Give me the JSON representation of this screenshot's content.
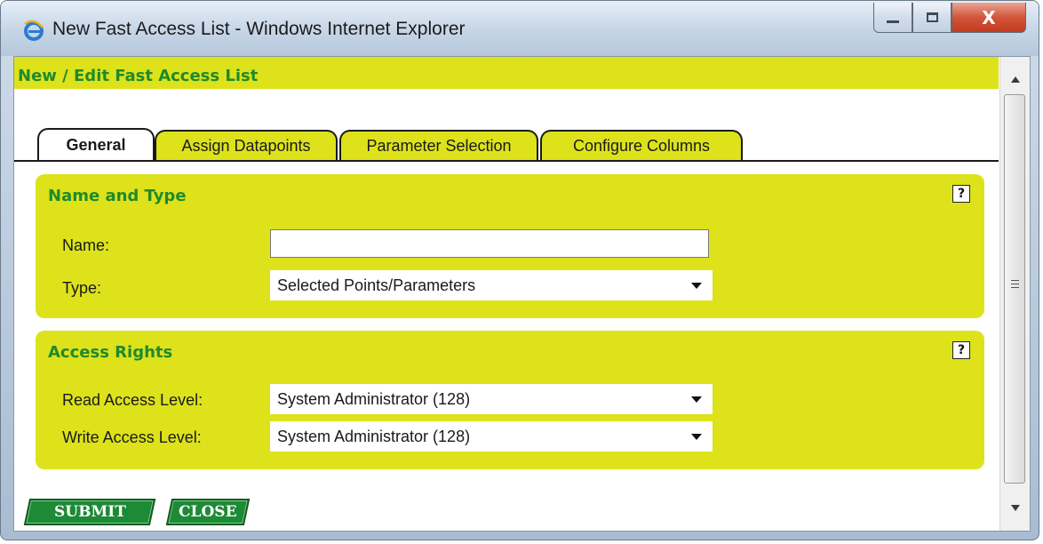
{
  "window": {
    "title": "New Fast Access List - Windows Internet Explorer",
    "close_glyph": "X"
  },
  "header": {
    "title": "New / Edit Fast Access List"
  },
  "tabs": [
    {
      "label": "General",
      "active": true
    },
    {
      "label": "Assign Datapoints",
      "active": false
    },
    {
      "label": "Parameter Selection",
      "active": false
    },
    {
      "label": "Configure Columns",
      "active": false
    }
  ],
  "name_type": {
    "title": "Name and Type",
    "help_glyph": "?",
    "name_label": "Name:",
    "name_value": "",
    "type_label": "Type:",
    "type_value": "Selected Points/Parameters"
  },
  "access": {
    "title": "Access Rights",
    "help_glyph": "?",
    "read_label": "Read Access Level:",
    "read_value": "System Administrator (128)",
    "write_label": "Write Access Level:",
    "write_value": "System Administrator (128)"
  },
  "buttons": {
    "submit": "SUBMIT",
    "close": "CLOSE"
  },
  "colors": {
    "panel": "#dde21a",
    "title_green": "#1f8a2c",
    "button_green": "#1d8a36"
  },
  "icons": {
    "browser": "ie-logo-icon",
    "help": "help-icon",
    "dropdown": "chevron-down-icon"
  }
}
